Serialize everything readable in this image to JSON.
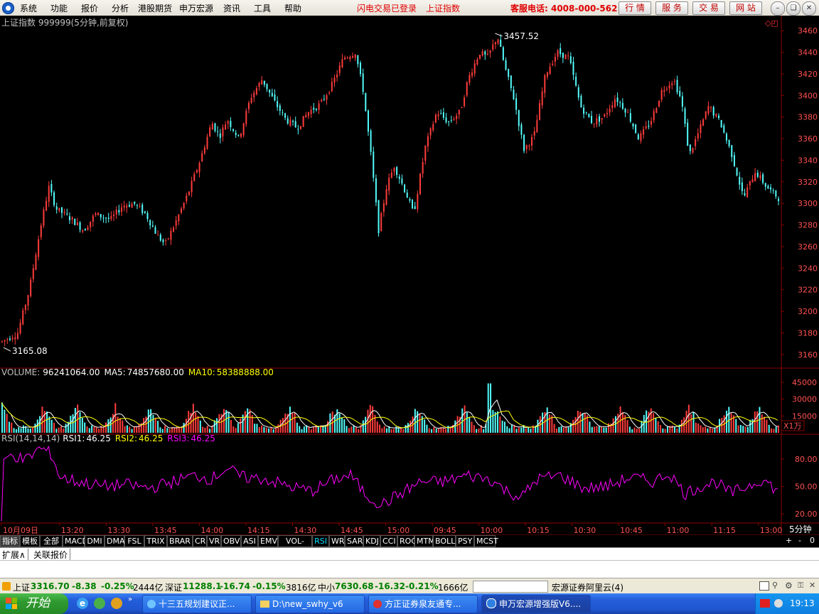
{
  "menu": {
    "items": [
      "系统",
      "功能",
      "报价",
      "分析",
      "港股期货",
      "申万宏源",
      "资讯",
      "工具",
      "帮助"
    ],
    "notice_login": "闪电交易已登录",
    "notice_index": "上证指数",
    "hotline": "客服电话: 4008-000-562",
    "service_buttons": [
      "行 情",
      "服 务",
      "交 易",
      "网 站"
    ]
  },
  "chart_header": {
    "title": "上证指数 999999(5分钟,前复权)"
  },
  "colors": {
    "up": "#ff3c3c",
    "down": "#54fcfc",
    "ma5": "#ffffff",
    "ma10": "#ffff00",
    "rsi": "#ff00ff",
    "grid": "#8b0000",
    "axis_text": "#ff5050"
  },
  "chart_data": [
    {
      "type": "candlestick",
      "title": "",
      "ylim": [
        3150,
        3470
      ],
      "y_ticks": [
        3460,
        3440,
        3420,
        3400,
        3380,
        3360,
        3340,
        3320,
        3300,
        3280,
        3260,
        3240,
        3220,
        3200,
        3180,
        3160
      ],
      "x_tick_labels": [
        "10月09日",
        "13:20",
        "13:30",
        "13:45",
        "14:00",
        "14:15",
        "14:30",
        "14:45",
        "15:00",
        "09:45",
        "10:00",
        "10:15",
        "10:30",
        "10:45",
        "11:00",
        "11:15",
        "13:00"
      ],
      "x_tick_positions": [
        0.0,
        0.075,
        0.135,
        0.195,
        0.255,
        0.315,
        0.375,
        0.435,
        0.495,
        0.555,
        0.615,
        0.675,
        0.735,
        0.795,
        0.855,
        0.915,
        0.975
      ],
      "annotations": [
        {
          "label": "3457.52",
          "x": 0.635,
          "value": 3457.52,
          "kind": "high"
        },
        {
          "label": "3165.08",
          "x": 0.0,
          "value": 3165.08,
          "kind": "low"
        }
      ],
      "close_path": [
        [
          0.0,
          3172
        ],
        [
          0.02,
          3180
        ],
        [
          0.035,
          3220
        ],
        [
          0.05,
          3280
        ],
        [
          0.06,
          3315
        ],
        [
          0.07,
          3295
        ],
        [
          0.09,
          3285
        ],
        [
          0.105,
          3275
        ],
        [
          0.12,
          3290
        ],
        [
          0.14,
          3285
        ],
        [
          0.155,
          3298
        ],
        [
          0.17,
          3300
        ],
        [
          0.185,
          3290
        ],
        [
          0.2,
          3270
        ],
        [
          0.21,
          3262
        ],
        [
          0.225,
          3285
        ],
        [
          0.24,
          3310
        ],
        [
          0.255,
          3340
        ],
        [
          0.27,
          3375
        ],
        [
          0.28,
          3362
        ],
        [
          0.29,
          3378
        ],
        [
          0.305,
          3360
        ],
        [
          0.32,
          3398
        ],
        [
          0.335,
          3415
        ],
        [
          0.35,
          3395
        ],
        [
          0.365,
          3378
        ],
        [
          0.38,
          3370
        ],
        [
          0.395,
          3385
        ],
        [
          0.41,
          3392
        ],
        [
          0.425,
          3410
        ],
        [
          0.44,
          3435
        ],
        [
          0.455,
          3440
        ],
        [
          0.465,
          3405
        ],
        [
          0.475,
          3345
        ],
        [
          0.485,
          3275
        ],
        [
          0.495,
          3315
        ],
        [
          0.505,
          3335
        ],
        [
          0.52,
          3310
        ],
        [
          0.53,
          3290
        ],
        [
          0.545,
          3352
        ],
        [
          0.56,
          3385
        ],
        [
          0.575,
          3375
        ],
        [
          0.59,
          3385
        ],
        [
          0.6,
          3415
        ],
        [
          0.615,
          3440
        ],
        [
          0.625,
          3435
        ],
        [
          0.638,
          3455
        ],
        [
          0.648,
          3425
        ],
        [
          0.66,
          3395
        ],
        [
          0.672,
          3350
        ],
        [
          0.685,
          3362
        ],
        [
          0.7,
          3420
        ],
        [
          0.715,
          3440
        ],
        [
          0.73,
          3435
        ],
        [
          0.745,
          3390
        ],
        [
          0.76,
          3375
        ],
        [
          0.775,
          3380
        ],
        [
          0.79,
          3398
        ],
        [
          0.805,
          3385
        ],
        [
          0.82,
          3360
        ],
        [
          0.835,
          3375
        ],
        [
          0.85,
          3405
        ],
        [
          0.865,
          3415
        ],
        [
          0.875,
          3395
        ],
        [
          0.885,
          3345
        ],
        [
          0.895,
          3362
        ],
        [
          0.91,
          3390
        ],
        [
          0.925,
          3375
        ],
        [
          0.94,
          3345
        ],
        [
          0.955,
          3305
        ],
        [
          0.97,
          3330
        ],
        [
          0.985,
          3315
        ],
        [
          1.0,
          3305
        ]
      ]
    },
    {
      "type": "bar",
      "title": "",
      "label_name": "VOLUME:",
      "label_value": "96241064.00",
      "ma5_label": "MA5:",
      "ma5_value": "74857680.00",
      "ma10_label": "MA10:",
      "ma10_value": "58388888.00",
      "ylim": [
        0,
        50000
      ],
      "y_ticks": [
        45000,
        30000,
        15000
      ],
      "unit": "X1万",
      "peaks": [
        0.0,
        0.055,
        0.095,
        0.145,
        0.19,
        0.245,
        0.285,
        0.315,
        0.37,
        0.43,
        0.475,
        0.535,
        0.595,
        0.635,
        0.7,
        0.745,
        0.795,
        0.835,
        0.885,
        0.935,
        0.975
      ]
    },
    {
      "type": "line",
      "title": "",
      "label_name": "RSI(14,14,14)",
      "rsi1_label": "RSI1:",
      "rsi1_value": "46.25",
      "rsi2_label": "RSI2:",
      "rsi2_value": "46.25",
      "rsi3_label": "RSI3:",
      "rsi3_value": "46.25",
      "ylim": [
        10,
        100
      ],
      "y_ticks": [
        80.0,
        50.0,
        20.0
      ],
      "y_tick_labels": [
        "80.00",
        "50.00",
        "20.00"
      ],
      "trend": [
        [
          0.0,
          10
        ],
        [
          0.003,
          80
        ],
        [
          0.015,
          85
        ],
        [
          0.03,
          78
        ],
        [
          0.05,
          92
        ],
        [
          0.065,
          85
        ],
        [
          0.075,
          60
        ],
        [
          0.1,
          55
        ],
        [
          0.13,
          50
        ],
        [
          0.16,
          52
        ],
        [
          0.19,
          48
        ],
        [
          0.22,
          55
        ],
        [
          0.25,
          62
        ],
        [
          0.27,
          58
        ],
        [
          0.29,
          70
        ],
        [
          0.31,
          60
        ],
        [
          0.34,
          58
        ],
        [
          0.37,
          50
        ],
        [
          0.4,
          45
        ],
        [
          0.43,
          58
        ],
        [
          0.45,
          62
        ],
        [
          0.47,
          40
        ],
        [
          0.49,
          30
        ],
        [
          0.51,
          40
        ],
        [
          0.54,
          55
        ],
        [
          0.57,
          55
        ],
        [
          0.6,
          62
        ],
        [
          0.63,
          58
        ],
        [
          0.65,
          45
        ],
        [
          0.67,
          38
        ],
        [
          0.69,
          58
        ],
        [
          0.72,
          62
        ],
        [
          0.75,
          48
        ],
        [
          0.78,
          50
        ],
        [
          0.81,
          60
        ],
        [
          0.84,
          55
        ],
        [
          0.86,
          65
        ],
        [
          0.88,
          42
        ],
        [
          0.9,
          50
        ],
        [
          0.92,
          55
        ],
        [
          0.94,
          42
        ],
        [
          0.96,
          50
        ],
        [
          0.98,
          58
        ],
        [
          1.0,
          45
        ]
      ]
    }
  ],
  "period_label": "5分钟",
  "indicator_tabs": [
    "指标",
    "模板",
    "全部",
    "MACD",
    "DMI",
    "DMA",
    "FSL",
    "TRIX",
    "BRAR",
    "CR",
    "VR",
    "OBV",
    "ASI",
    "EMV",
    "VOL-TDX",
    "RSI",
    "WR",
    "SAR",
    "KDJ",
    "CCI",
    "ROC",
    "MTM",
    "BOLL",
    "PSY",
    "MCST"
  ],
  "active_tab": "RSI",
  "zoom_controls": [
    "+",
    "-",
    "0"
  ],
  "lower_tabs": [
    "扩展∧",
    "关联报价"
  ],
  "status": {
    "sh_name": "上证",
    "sh_value": "3316.70",
    "sh_change": "-8.38",
    "sh_pct": "-0.25%",
    "sh_amount": "2444亿",
    "sz_name": "深证",
    "sz_value": "11288.1",
    "sz_change": "-16.74",
    "sz_pct": "-0.15%",
    "sz_amount": "3816亿",
    "sme_name": "中小",
    "sme_value": "7630.68",
    "sme_change": "-16.32",
    "sme_pct": "-0.21%",
    "sme_amount": "1666亿",
    "server": "宏源证券阿里云(4)"
  },
  "taskbar": {
    "start": "开始",
    "tasks": [
      "十三五规划建议正...",
      "D:\\new_swhy_v6",
      "方正证券泉友通专...",
      "申万宏源增强版V6...."
    ],
    "clock": "19:13"
  }
}
